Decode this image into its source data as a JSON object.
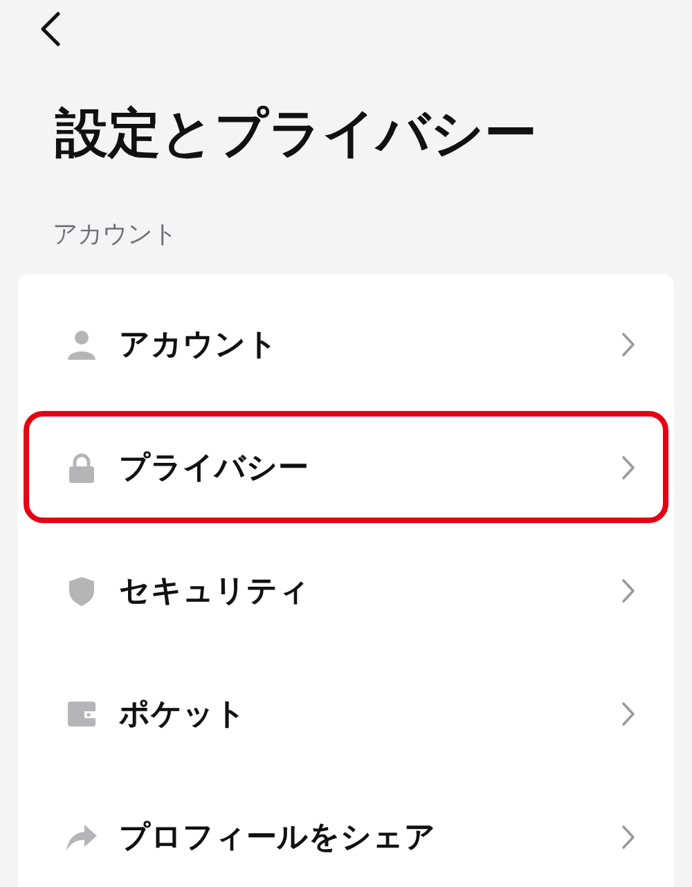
{
  "header": {
    "title": "設定とプライバシー"
  },
  "section": {
    "label": "アカウント",
    "items": [
      {
        "kind": "person",
        "label": "アカウント",
        "highlighted": false
      },
      {
        "kind": "lock",
        "label": "プライバシー",
        "highlighted": true
      },
      {
        "kind": "shield",
        "label": "セキュリティ",
        "highlighted": false
      },
      {
        "kind": "wallet",
        "label": "ポケット",
        "highlighted": false
      },
      {
        "kind": "share",
        "label": "プロフィールをシェア",
        "highlighted": false
      }
    ]
  }
}
